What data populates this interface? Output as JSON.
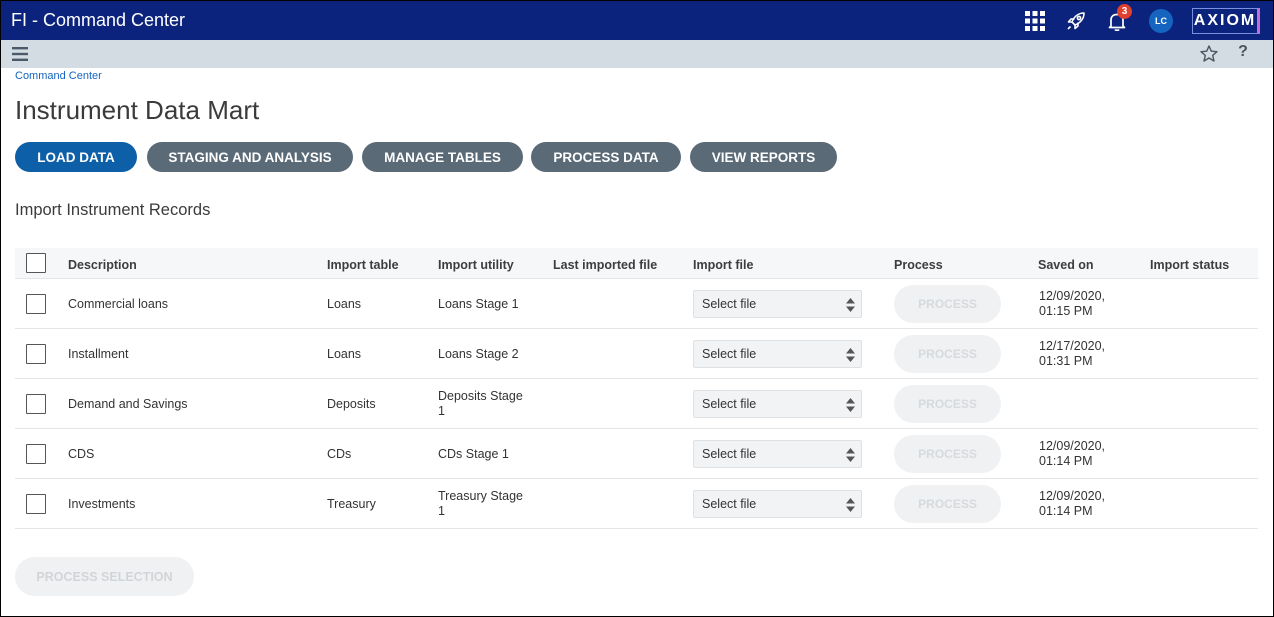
{
  "header": {
    "app_title": "FI - Command Center",
    "notification_count": "3",
    "avatar_initials": "LC",
    "logo_text": "AXIOM",
    "brand_color": "#0b237d"
  },
  "subbar": {
    "help_label": "?"
  },
  "breadcrumb": "Command Center",
  "page_title": "Instrument Data Mart",
  "tabs": [
    {
      "label": "LOAD DATA",
      "active": true
    },
    {
      "label": "STAGING AND ANALYSIS",
      "active": false
    },
    {
      "label": "MANAGE TABLES",
      "active": false
    },
    {
      "label": "PROCESS DATA",
      "active": false
    },
    {
      "label": "VIEW REPORTS",
      "active": false
    }
  ],
  "section_title": "Import Instrument Records",
  "table": {
    "columns": [
      "Description",
      "Import table",
      "Import utility",
      "Last imported file",
      "Import file",
      "Process",
      "Saved on",
      "Import status"
    ],
    "rows": [
      {
        "description": "Commercial loans",
        "import_table": "Loans",
        "utility_line1": "Loans Stage 1",
        "utility_line2": "",
        "last_file": "",
        "import_file": "Select file",
        "process": "PROCESS",
        "saved_line1": "12/09/2020,",
        "saved_line2": "01:15 PM",
        "status": ""
      },
      {
        "description": "Installment",
        "import_table": "Loans",
        "utility_line1": "Loans Stage 2",
        "utility_line2": "",
        "last_file": "",
        "import_file": "Select file",
        "process": "PROCESS",
        "saved_line1": "12/17/2020,",
        "saved_line2": "01:31 PM",
        "status": ""
      },
      {
        "description": "Demand and Savings",
        "import_table": "Deposits",
        "utility_line1": "Deposits Stage",
        "utility_line2": "1",
        "last_file": "",
        "import_file": "Select file",
        "process": "PROCESS",
        "saved_line1": "",
        "saved_line2": "",
        "status": ""
      },
      {
        "description": "CDS",
        "import_table": "CDs",
        "utility_line1": "CDs Stage 1",
        "utility_line2": "",
        "last_file": "",
        "import_file": "Select file",
        "process": "PROCESS",
        "saved_line1": "12/09/2020,",
        "saved_line2": "01:14 PM",
        "status": ""
      },
      {
        "description": "Investments",
        "import_table": "Treasury",
        "utility_line1": "Treasury Stage",
        "utility_line2": "1",
        "last_file": "",
        "import_file": "Select file",
        "process": "PROCESS",
        "saved_line1": "12/09/2020,",
        "saved_line2": "01:14 PM",
        "status": ""
      }
    ]
  },
  "process_selection_label": "PROCESS SELECTION"
}
